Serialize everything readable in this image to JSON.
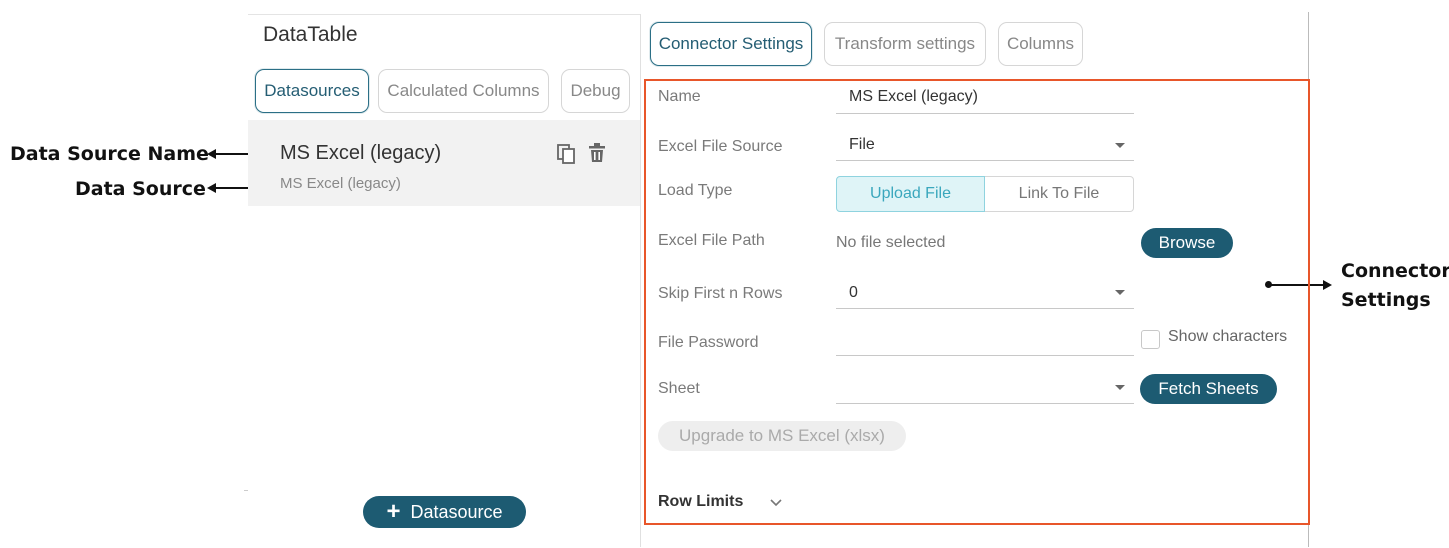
{
  "annotations": {
    "data_source_name": "Data Source Name",
    "data_source": "Data Source",
    "connector_settings_line1": "Connector",
    "connector_settings_line2": "Settings"
  },
  "left_panel": {
    "title": "DataTable",
    "tabs": [
      {
        "label": "Datasources",
        "active": true
      },
      {
        "label": "Calculated Columns",
        "active": false
      },
      {
        "label": "Debug",
        "active": false
      }
    ],
    "datasource_item": {
      "name": "MS Excel (legacy)",
      "source": "MS Excel (legacy)",
      "icons": [
        "copy-icon",
        "trash-icon"
      ]
    },
    "add_button": {
      "icon": "plus-icon",
      "label": "Datasource"
    }
  },
  "right_panel": {
    "tabs": [
      {
        "label": "Connector Settings",
        "active": true
      },
      {
        "label": "Transform settings",
        "active": false
      },
      {
        "label": "Columns",
        "active": false
      }
    ],
    "form": {
      "name": {
        "label": "Name",
        "value": "MS Excel (legacy)"
      },
      "excel_file_source": {
        "label": "Excel File Source",
        "value": "File"
      },
      "load_type": {
        "label": "Load Type",
        "options": [
          "Upload File",
          "Link To File"
        ],
        "selected": "Upload File"
      },
      "excel_file_path": {
        "label": "Excel File Path",
        "value": "No file selected",
        "button": "Browse"
      },
      "skip_first_n_rows": {
        "label": "Skip First n Rows",
        "value": "0"
      },
      "file_password": {
        "label": "File Password",
        "value": "",
        "show_characters_label": "Show characters",
        "show_characters_checked": false
      },
      "sheet": {
        "label": "Sheet",
        "value": "",
        "button": "Fetch Sheets"
      },
      "upgrade_button": "Upgrade to MS Excel (xlsx)",
      "row_limits": "Row Limits"
    }
  },
  "colors": {
    "accent": "#1d5b72",
    "highlight_border": "#e8562a",
    "segment_active_bg": "#dff4f7",
    "segment_active_text": "#3aa7bd"
  }
}
